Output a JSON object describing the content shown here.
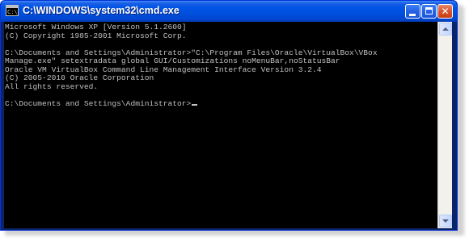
{
  "window": {
    "title": "C:\\WINDOWS\\system32\\cmd.exe",
    "icon_glyph": "C:\\",
    "icon": "cmd-icon",
    "controls": {
      "minimize_icon": "minimize-icon",
      "maximize_icon": "maximize-icon",
      "close_icon": "close-icon",
      "close_glyph": "✕"
    }
  },
  "console": {
    "lines": [
      "Microsoft Windows XP [Version 5.1.2600]",
      "(C) Copyright 1985-2001 Microsoft Corp.",
      "",
      "C:\\Documents and Settings\\Administrator>\"C:\\Program Files\\Oracle\\VirtualBox\\VBox",
      "Manage.exe\" setextradata global GUI/Customizations noMenuBar,noStatusBar",
      "Oracle VM VirtualBox Command Line Management Interface Version 3.2.4",
      "(C) 2005-2010 Oracle Corporation",
      "All rights reserved.",
      "",
      "C:\\Documents and Settings\\Administrator>"
    ],
    "text_color": "#c0c0c0",
    "background_color": "#000000"
  },
  "scrollbar": {
    "up_icon": "arrow-up-icon",
    "down_icon": "arrow-down-icon"
  }
}
